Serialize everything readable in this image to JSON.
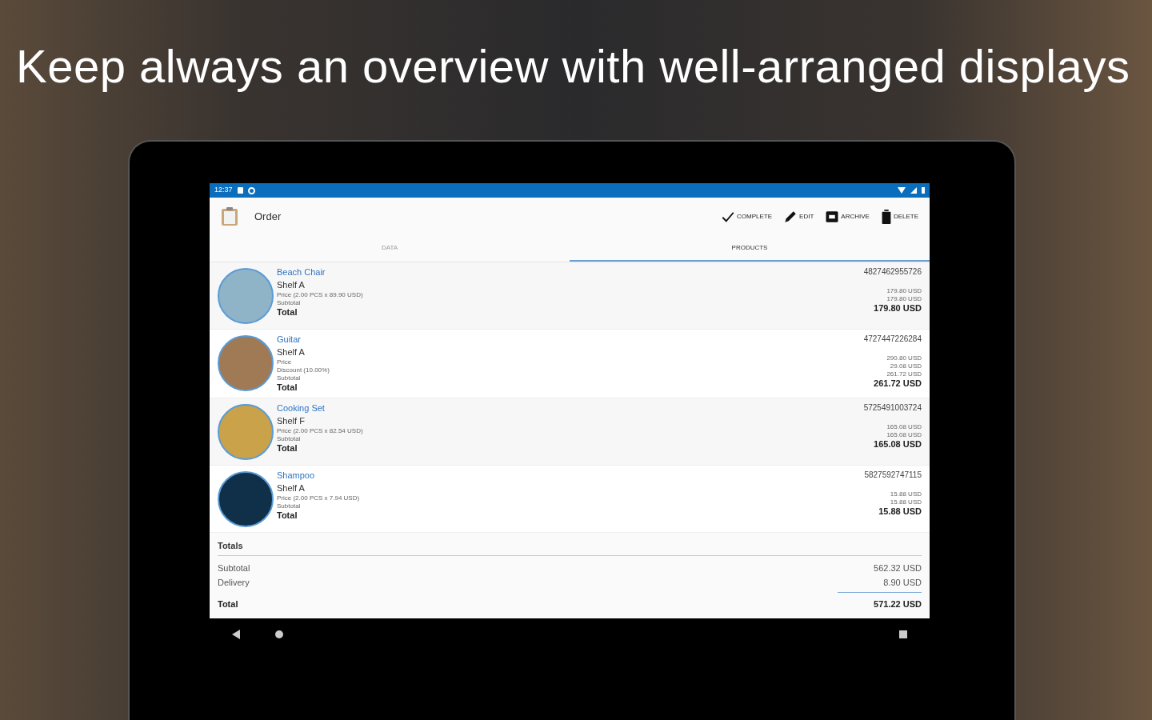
{
  "headline": "Keep always an overview with well-arranged displays",
  "status_bar": {
    "time": "12:37"
  },
  "app_bar": {
    "title": "Order",
    "actions": [
      {
        "kind": "check",
        "label": "COMPLETE"
      },
      {
        "kind": "pencil",
        "label": "EDIT"
      },
      {
        "kind": "archive",
        "label": "ARCHIVE"
      },
      {
        "kind": "trash",
        "label": "DELETE"
      }
    ]
  },
  "tabs": [
    {
      "label": "DATA",
      "selected": false
    },
    {
      "label": "PRODUCTS",
      "selected": true
    }
  ],
  "products": [
    {
      "name": "Beach Chair",
      "location": "Shelf A",
      "barcode": "4827462955726",
      "lines": [
        {
          "label": "Price (2.00 PCS x 89.90 USD)",
          "value": "179.80 USD"
        },
        {
          "label": "Subtotal",
          "value": "179.80 USD"
        }
      ],
      "total_label": "Total",
      "total": "179.80 USD"
    },
    {
      "name": "Guitar",
      "location": "Shelf A",
      "barcode": "4727447226284",
      "lines": [
        {
          "label": "Price",
          "value": "290.80 USD"
        },
        {
          "label": "Discount (10.00%)",
          "value": "29.08 USD"
        },
        {
          "label": "Subtotal",
          "value": "261.72 USD"
        }
      ],
      "total_label": "Total",
      "total": "261.72 USD"
    },
    {
      "name": "Cooking Set",
      "location": "Shelf F",
      "barcode": "5725491003724",
      "lines": [
        {
          "label": "Price (2.00 PCS x 82.54 USD)",
          "value": "165.08 USD"
        },
        {
          "label": "Subtotal",
          "value": "165.08 USD"
        }
      ],
      "total_label": "Total",
      "total": "165.08 USD"
    },
    {
      "name": "Shampoo",
      "location": "Shelf A",
      "barcode": "5827592747115",
      "lines": [
        {
          "label": "Price (2.00 PCS x 7.94 USD)",
          "value": "15.88 USD"
        },
        {
          "label": "Subtotal",
          "value": "15.88 USD"
        }
      ],
      "total_label": "Total",
      "total": "15.88 USD"
    }
  ],
  "totals": {
    "title": "Totals",
    "rows": [
      {
        "label": "Subtotal",
        "value": "562.32 USD"
      },
      {
        "label": "Delivery",
        "value": "8.90 USD"
      }
    ],
    "total_label": "Total",
    "total": "571.22 USD"
  }
}
